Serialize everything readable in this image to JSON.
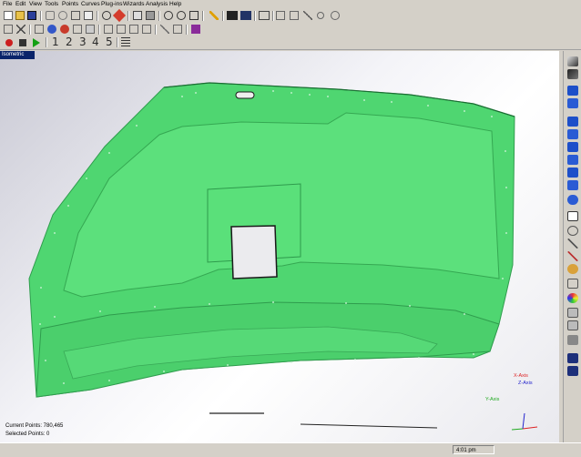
{
  "menu": [
    "File",
    "Edit",
    "View",
    "Tools",
    "Points",
    "Curves",
    "Plug-ins",
    "Wizards",
    "Analysis",
    "Help"
  ],
  "toolbar": {
    "row1_icons": [
      "new-icon",
      "open-icon",
      "save-icon",
      "select-icon",
      "rotate-icon",
      "pan-icon",
      "box-icon",
      "fit-icon",
      "target-icon",
      "zoom-in-icon",
      "zoom-out-icon",
      "zoom-box-icon",
      "pencil-icon",
      "layer-icon",
      "layer2-icon",
      "display-icon",
      "points-icon",
      "brush-icon",
      "circle-icon",
      "gear-icon"
    ],
    "row2_icons": [
      "grid-icon",
      "close-icon",
      "merge-icon",
      "sample-icon",
      "group-icon",
      "curve-icon",
      "list-icon",
      "filter-icon",
      "sample2-icon",
      "arrow-icon",
      "compare-icon"
    ],
    "play_icons": [
      "record-icon",
      "stop-icon",
      "play-icon"
    ],
    "steps": [
      "1",
      "2",
      "3",
      "4",
      "5"
    ],
    "list_icon": "list-icon"
  },
  "viewport": {
    "tab_label": "Isometric",
    "current_points_label": "Current Points: 780,465",
    "selected_points_label": "Selected Points: 0",
    "axis": {
      "x_label": "X-Axis",
      "z_label": "Z-Axis",
      "y_label": "Y-Axis"
    },
    "model_color": "#4fd671"
  },
  "right_tools": [
    "shade-icon",
    "wire-icon",
    "view-front-icon",
    "view-back-icon",
    "view-left-icon",
    "view-right-icon",
    "view-top-icon",
    "view-bottom-icon",
    "view-iso-icon",
    "view-iso2-icon",
    "view-iso3-icon",
    "view-iso4-icon",
    "select-icon",
    "lasso-icon",
    "brush-select-icon",
    "paint-icon",
    "star-icon",
    "brush-icon",
    "color-icon",
    "sort-icon",
    "filter-icon",
    "surface-icon",
    "camera-icon",
    "camera2-icon"
  ],
  "status": {
    "clock": "4:01 pm"
  },
  "colors": {
    "chrome": "#d4d0c8",
    "model": "#4fd671",
    "tab": "#0a246a"
  }
}
